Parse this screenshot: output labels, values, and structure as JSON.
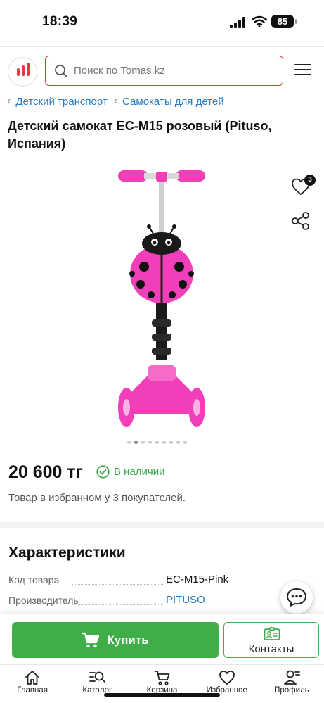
{
  "status_bar": {
    "time": "18:39",
    "battery": "85"
  },
  "header": {
    "search": {
      "placeholder": "Поиск по Tomas.kz"
    },
    "logo_icon": "tomas-logo-bars",
    "menu_icon": "hamburger-menu-icon"
  },
  "breadcrumb": {
    "items": [
      "Детский транспорт",
      "Самокаты для детей"
    ]
  },
  "product": {
    "title": "Детский самокат EC-M15 розовый (Pituso, Испания)",
    "favorites_count": "3",
    "gallery_total": 9,
    "gallery_active": 2,
    "price": "20 600 тг",
    "availability": "В наличии",
    "favorites_note": "Товар в избранном у 3 покупателей."
  },
  "specs": {
    "title": "Характеристики",
    "rows": [
      {
        "label": "Код товара",
        "value": "EC-M15-Pink"
      },
      {
        "label": "Производитель",
        "value": "PITUSO"
      }
    ]
  },
  "actions": {
    "buy": "Купить",
    "contacts": "Контакты"
  },
  "bottom_nav": {
    "items": [
      {
        "label": "Главная",
        "icon": "home-icon"
      },
      {
        "label": "Каталог",
        "icon": "catalog-search-icon"
      },
      {
        "label": "Корзина",
        "icon": "cart-icon"
      },
      {
        "label": "Избранное",
        "icon": "heart-icon"
      },
      {
        "label": "Профиль",
        "icon": "profile-icon"
      }
    ]
  },
  "colors": {
    "accent_red": "#e8383d",
    "green": "#3fae49",
    "link_blue": "#2a7bc0",
    "product_pink": "#f03fb8"
  }
}
